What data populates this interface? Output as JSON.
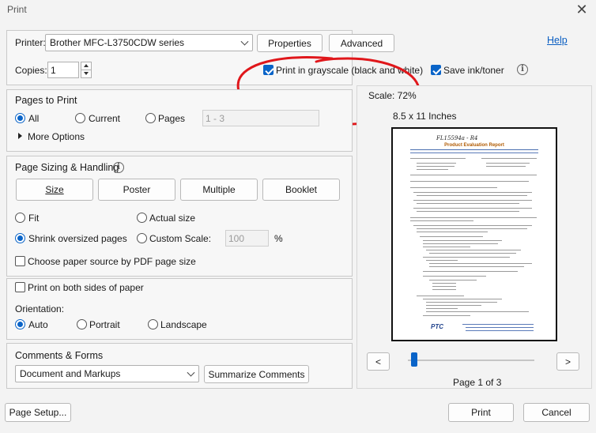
{
  "window": {
    "title": "Print",
    "close_glyph": "✕"
  },
  "printer": {
    "label": "Printer:",
    "selected": "Brother MFC-L3750CDW series",
    "properties_label": "Properties",
    "advanced_label": "Advanced",
    "help_label": "Help",
    "copies_label": "Copies:",
    "copies_value": "1",
    "grayscale_label": "Print in grayscale (black and white)",
    "grayscale_checked": true,
    "save_ink_label": "Save ink/toner",
    "save_ink_checked": true,
    "info_glyph": "i"
  },
  "pages_to_print": {
    "title": "Pages to Print",
    "all_label": "All",
    "current_label": "Current",
    "pages_label": "Pages",
    "pages_range_placeholder": "1 - 3",
    "selected": "All",
    "more_options_label": "More Options"
  },
  "sizing": {
    "title": "Page Sizing & Handling",
    "info_glyph": "i",
    "tabs": [
      "Size",
      "Poster",
      "Multiple",
      "Booklet"
    ],
    "fit_label": "Fit",
    "actual_size_label": "Actual size",
    "shrink_label": "Shrink oversized pages",
    "custom_scale_label": "Custom Scale:",
    "custom_scale_value": "100",
    "percent_label": "%",
    "selected": "Shrink oversized pages",
    "paper_source_label": "Choose paper source by PDF page size",
    "paper_source_checked": false,
    "both_sides_label": "Print on both sides of paper",
    "both_sides_checked": false,
    "orientation_label": "Orientation:",
    "orientation_options": [
      "Auto",
      "Portrait",
      "Landscape"
    ],
    "orientation_selected": "Auto"
  },
  "comments": {
    "title": "Comments & Forms",
    "selected": "Document and Markups",
    "summarize_label": "Summarize Comments"
  },
  "preview": {
    "scale_label": "Scale:  72%",
    "paper_size_label": "8.5 x 11 Inches",
    "doc_handwriting": "FL15594a - R4",
    "doc_title": "Product Evaluation Report",
    "doc_logo": "PTC",
    "prev_glyph": "<",
    "next_glyph": ">",
    "page_indicator": "Page 1 of 3",
    "current_page": 1,
    "total_pages": 3
  },
  "footer": {
    "page_setup_label": "Page Setup...",
    "print_label": "Print",
    "cancel_label": "Cancel"
  },
  "annotation": {
    "color": "#e0171b"
  },
  "colors": {
    "accent": "#0a64c8",
    "link": "#0a5ec2"
  }
}
